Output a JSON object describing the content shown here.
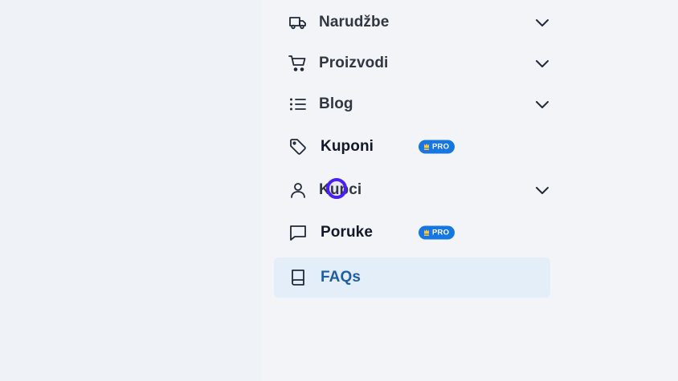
{
  "nav": {
    "items": [
      {
        "label": "Narudžbe",
        "icon": "truck-icon",
        "has_chevron": true
      },
      {
        "label": "Proizvodi",
        "icon": "cart-icon",
        "has_chevron": true
      },
      {
        "label": "Blog",
        "icon": "list-icon",
        "has_chevron": true
      },
      {
        "label": "Kuponi",
        "icon": "tag-icon",
        "badge": "PRO"
      },
      {
        "label": "Kupci",
        "icon": "user-icon",
        "has_chevron": true
      },
      {
        "label": "Poruke",
        "icon": "message-icon",
        "badge": "PRO"
      },
      {
        "label": "FAQs",
        "icon": "book-icon",
        "active": true
      }
    ]
  },
  "colors": {
    "accent": "#1677e3",
    "active_bg": "#e3eef9",
    "active_text": "#1f5f9e",
    "cursor": "#4b1ff0"
  }
}
